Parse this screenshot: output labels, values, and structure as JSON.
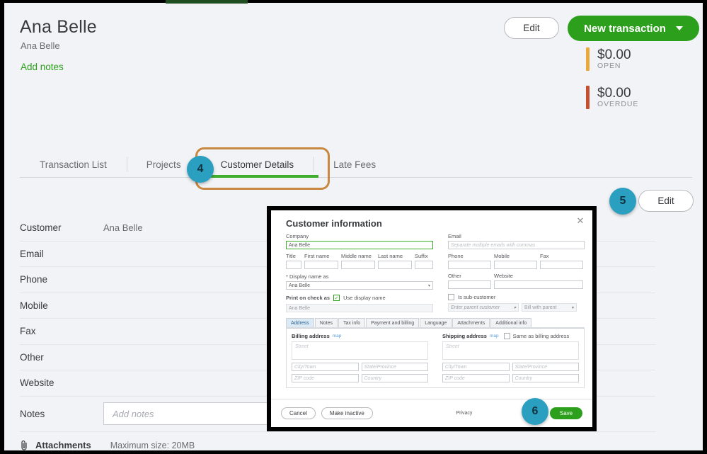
{
  "header": {
    "title": "Ana Belle",
    "subtitle": "Ana Belle",
    "add_notes_link": "Add notes",
    "edit_label": "Edit",
    "new_transaction_label": "New transaction",
    "stats": [
      {
        "amount": "$0.00",
        "label": "OPEN",
        "color": "#eaa83a"
      },
      {
        "amount": "$0.00",
        "label": "OVERDUE",
        "color": "#c44f2e"
      }
    ]
  },
  "tabs": [
    {
      "label": "Transaction List",
      "active": false
    },
    {
      "label": "Projects",
      "active": false
    },
    {
      "label": "Customer Details",
      "active": true
    },
    {
      "label": "Late Fees",
      "active": false
    }
  ],
  "annotations": [
    {
      "number": "4",
      "target": "customer-details-tab"
    },
    {
      "number": "5",
      "target": "edit-button"
    },
    {
      "number": "6",
      "target": "save-button"
    }
  ],
  "details": {
    "edit_label": "Edit",
    "rows": [
      {
        "label": "Customer",
        "value": "Ana Belle"
      },
      {
        "label": "Email",
        "value": ""
      },
      {
        "label": "Phone",
        "value": ""
      },
      {
        "label": "Mobile",
        "value": ""
      },
      {
        "label": "Fax",
        "value": ""
      },
      {
        "label": "Other",
        "value": ""
      },
      {
        "label": "Website",
        "value": ""
      }
    ],
    "notes_label": "Notes",
    "notes_placeholder": "Add notes",
    "attachments_label": "Attachments",
    "attachments_max": "Maximum size: 20MB"
  },
  "modal": {
    "title": "Customer information",
    "close_icon": "close-icon",
    "company_label": "Company",
    "company_value": "Ana Belle",
    "name_fields": [
      {
        "label": "Title",
        "value": ""
      },
      {
        "label": "First name",
        "value": ""
      },
      {
        "label": "Middle name",
        "value": ""
      },
      {
        "label": "Last name",
        "value": ""
      },
      {
        "label": "Suffix",
        "value": ""
      }
    ],
    "display_name_label": "* Display name as",
    "display_name_value": "Ana Belle",
    "print_on_check_label": "Print on check as",
    "use_display_name_label": "Use display name",
    "use_display_name_checked": true,
    "print_on_check_value": "Ana Belle",
    "email_label": "Email",
    "email_placeholder": "Separate multiple emails with commas",
    "phone_label": "Phone",
    "phone_value": "",
    "mobile_label": "Mobile",
    "mobile_value": "",
    "fax_label": "Fax",
    "fax_value": "",
    "other_label": "Other",
    "other_value": "",
    "website_label": "Website",
    "website_value": "",
    "is_sub_customer_label": "Is sub-customer",
    "is_sub_customer_checked": false,
    "parent_customer_placeholder": "Enter parent customer",
    "bill_with_parent_label": "Bill with parent",
    "tabs": [
      {
        "label": "Address",
        "active": true
      },
      {
        "label": "Notes",
        "active": false
      },
      {
        "label": "Tax info",
        "active": false
      },
      {
        "label": "Payment and billing",
        "active": false
      },
      {
        "label": "Language",
        "active": false
      },
      {
        "label": "Attachments",
        "active": false
      },
      {
        "label": "Additional info",
        "active": false
      }
    ],
    "billing": {
      "heading": "Billing address",
      "map_link": "map",
      "street_placeholder": "Street",
      "city_placeholder": "City/Town",
      "state_placeholder": "State/Province",
      "zip_placeholder": "ZIP code",
      "country_placeholder": "Country"
    },
    "shipping": {
      "heading": "Shipping address",
      "map_link": "map",
      "same_as_billing_label": "Same as billing address",
      "same_as_billing_checked": false,
      "street_placeholder": "Street",
      "city_placeholder": "City/Town",
      "state_placeholder": "State/Province",
      "zip_placeholder": "ZIP code",
      "country_placeholder": "Country"
    },
    "footer": {
      "cancel_label": "Cancel",
      "make_inactive_label": "Make inactive",
      "privacy_label": "Privacy",
      "save_label": "Save"
    }
  },
  "colors": {
    "brand_green": "#2ca01c",
    "underline_green": "#3fae2a",
    "highlight_orange": "#c8883f",
    "badge_blue": "#2a9fc0",
    "open_amber": "#eaa83a",
    "overdue_red": "#c44f2e"
  }
}
